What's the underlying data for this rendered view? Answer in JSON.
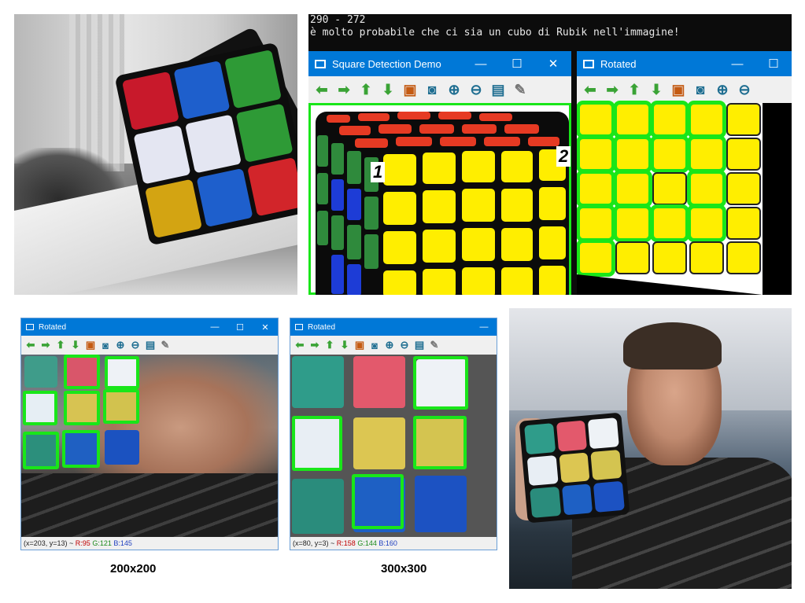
{
  "terminal": {
    "line1": "290 - 272",
    "line2": "è molto probabile che ci sia un cubo di Rubik nell'immagine!"
  },
  "window_main": {
    "title": "Square Detection Demo",
    "controls": [
      "—",
      "☐",
      "✕"
    ],
    "markers": [
      "1",
      "2"
    ]
  },
  "window_rotated_top": {
    "title": "Rotated",
    "controls": [
      "—",
      "☐"
    ]
  },
  "toolbar_icons": [
    "arrow-left-icon",
    "arrow-right-icon",
    "arrow-up-icon",
    "arrow-down-icon",
    "image-icon",
    "zoom-region-icon",
    "zoom-in-icon",
    "zoom-out-icon",
    "save-icon",
    "brush-icon"
  ],
  "window_200": {
    "title": "Rotated",
    "controls": [
      "—",
      "☐",
      "✕"
    ],
    "status": {
      "coords": "(x=203, y=13) ~ ",
      "r": "R:95",
      "g": "G:121",
      "b": "B:145"
    },
    "caption": "200x200"
  },
  "window_300": {
    "title": "Rotated",
    "controls": [
      "—"
    ],
    "status": {
      "coords": "(x=80, y=3) ~ ",
      "r": "R:158",
      "g": "G:144",
      "b": "B:160"
    },
    "caption": "300x300"
  },
  "colors": {
    "title_bar": "#0078d7",
    "detection_outline": "#19e619",
    "cube_yellow": "#ffee00",
    "cube_red": "#e63a23",
    "cube_green": "#2f8a3c",
    "cube_blue": "#1d3cd6"
  }
}
